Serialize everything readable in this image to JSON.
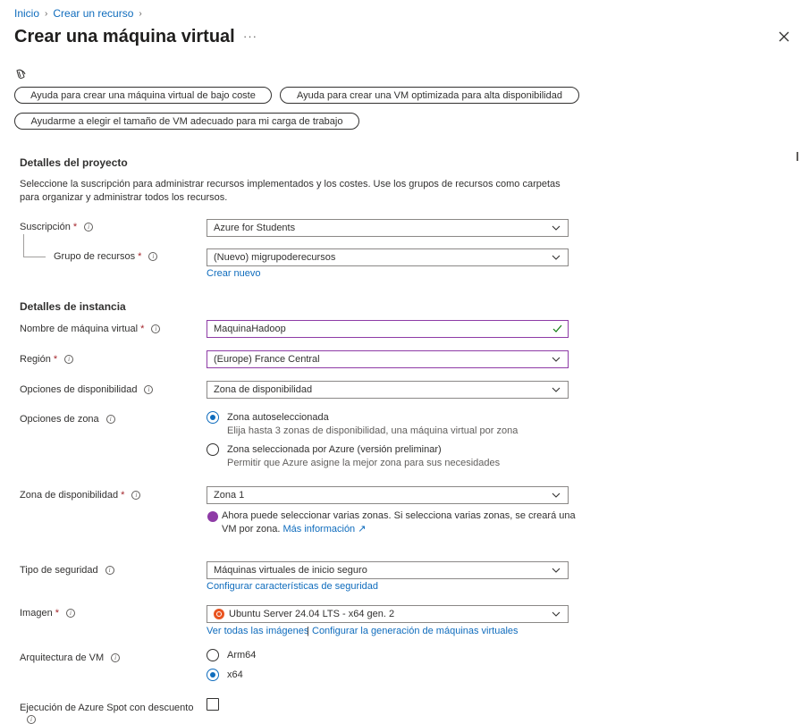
{
  "breadcrumb": {
    "items": [
      "Inicio",
      "Crear un recurso"
    ]
  },
  "header": {
    "title": "Crear una máquina virtual",
    "more": "···"
  },
  "quick_buttons": [
    "Ayuda para crear una máquina virtual de bajo coste",
    "Ayuda para crear una VM optimizada para alta disponibilidad",
    "Ayudarme a elegir el tamaño de VM adecuado para mi carga de trabajo"
  ],
  "project": {
    "title": "Detalles del proyecto",
    "description": "Seleccione la suscripción para administrar recursos implementados y los costes. Use los grupos de recursos como carpetas para organizar y administrar todos los recursos.",
    "subscription_label": "Suscripción",
    "subscription_value": "Azure for Students",
    "resource_group_label": "Grupo de recursos",
    "resource_group_value": "(Nuevo) migrupoderecursos",
    "create_new": "Crear nuevo"
  },
  "instance": {
    "title": "Detalles de instancia",
    "vm_name_label": "Nombre de máquina virtual",
    "vm_name_value": "MaquinaHadoop",
    "region_label": "Región",
    "region_value": "(Europe) France Central",
    "availability_label": "Opciones de disponibilidad",
    "availability_value": "Zona de disponibilidad",
    "zone_options_label": "Opciones de zona",
    "zone_option_1": "Zona autoseleccionada",
    "zone_option_1_desc": "Elija hasta 3 zonas de disponibilidad, una máquina virtual por zona",
    "zone_option_2": "Zona seleccionada por Azure (versión preliminar)",
    "zone_option_2_desc": "Permitir que Azure asigne la mejor zona para sus necesidades",
    "zone_label": "Zona de disponibilidad",
    "zone_value": "Zona 1",
    "zone_notice": "Ahora puede seleccionar varias zonas. Si selecciona varias zonas, se creará una VM por zona.",
    "zone_notice_link": "Más información",
    "security_label": "Tipo de seguridad",
    "security_value": "Máquinas virtuales de inicio seguro",
    "security_link": "Configurar características de seguridad",
    "image_label": "Imagen",
    "image_value": "Ubuntu Server 24.04 LTS - x64 gen. 2",
    "image_link_1": "Ver todas las imágenes",
    "image_link_sep": "|",
    "image_link_2": "Configurar la generación de máquinas virtuales",
    "arch_label": "Arquitectura de VM",
    "arch_option_1": "Arm64",
    "arch_option_2": "x64",
    "spot_label": "Ejecución de Azure Spot con descuento"
  },
  "colors": {
    "link": "#0f6cbd",
    "required": "#a4262c",
    "focus_border": "#8e3ba6",
    "valid_check": "#107c10"
  }
}
